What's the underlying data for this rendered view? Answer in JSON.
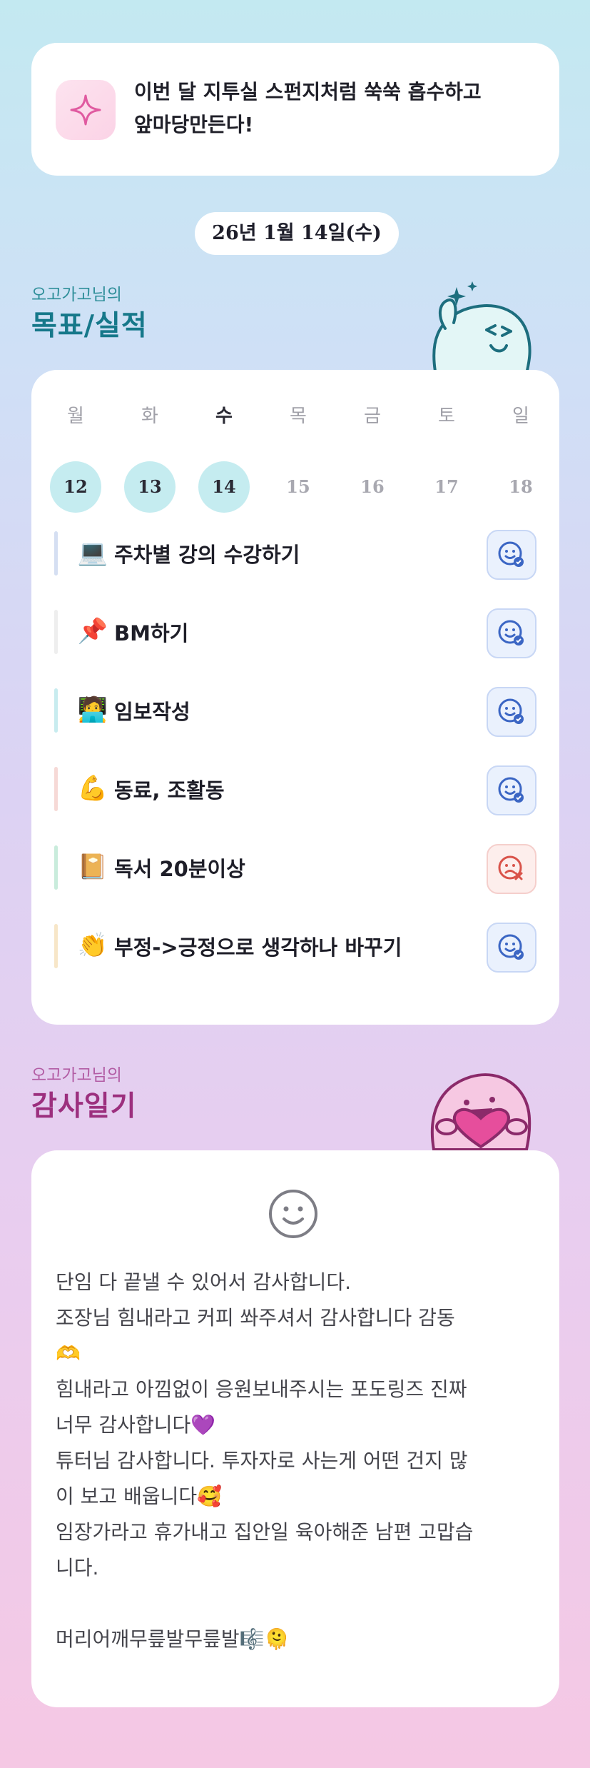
{
  "quote": {
    "text": "이번 달 지투실 스펀지처럼 쑥쑥 흡수하고\n앞마당만든다!",
    "icon": "sparkle-icon"
  },
  "date": "26년 1월 14일(수)",
  "goals_section": {
    "subtitle": "오고가고님의",
    "title": "목표/실적"
  },
  "week": {
    "days": [
      {
        "name": "월",
        "num": "12",
        "done": true,
        "today": false
      },
      {
        "name": "화",
        "num": "13",
        "done": true,
        "today": false
      },
      {
        "name": "수",
        "num": "14",
        "done": true,
        "today": true
      },
      {
        "name": "목",
        "num": "15",
        "done": false,
        "today": false
      },
      {
        "name": "금",
        "num": "16",
        "done": false,
        "today": false
      },
      {
        "name": "토",
        "num": "17",
        "done": false,
        "today": false
      },
      {
        "name": "일",
        "num": "18",
        "done": false,
        "today": false
      }
    ]
  },
  "goals": [
    {
      "emoji": "💻",
      "label": "주차별 강의 수강하기",
      "status": "done",
      "bar_color": "#d5dff2"
    },
    {
      "emoji": "📌",
      "label": "BM하기",
      "status": "done",
      "bar_color": "#eeeeee"
    },
    {
      "emoji": "🧑‍💻",
      "label": "임보작성",
      "status": "done",
      "bar_color": "#c8ecef"
    },
    {
      "emoji": "💪",
      "label": "동료, 조활동",
      "status": "done",
      "bar_color": "#f6d9d6"
    },
    {
      "emoji": "📔",
      "label": "독서 20분이상",
      "status": "failed",
      "bar_color": "#c9ecdc"
    },
    {
      "emoji": "👏",
      "label": "부정->긍정으로 생각하나 바꾸기",
      "status": "done",
      "bar_color": "#f7e6c8"
    }
  ],
  "thanks_section": {
    "subtitle": "오고가고님의",
    "title": "감사일기"
  },
  "diary": "단임 다 끝낼 수 있어서 감사합니다.\n조장님 힘내라고 커피 쏴주셔서 감사합니다 감동\n🫶\n힘내라고 아낌없이 응원보내주시는 포도링즈 진짜\n너무 감사합니다💜\n튜터님 감사합니다. 투자자로 사는게 어떤 건지 많\n이 보고 배웁니다🥰\n임장가라고 휴가내고 집안일 육아해준 남편 고맙습\n니다.\n\n머리어깨무릎발무릎발🎼🫠",
  "colors": {
    "teal": "#16788a",
    "magenta": "#9c2f7e",
    "done_bg": "#c5ecf0"
  }
}
